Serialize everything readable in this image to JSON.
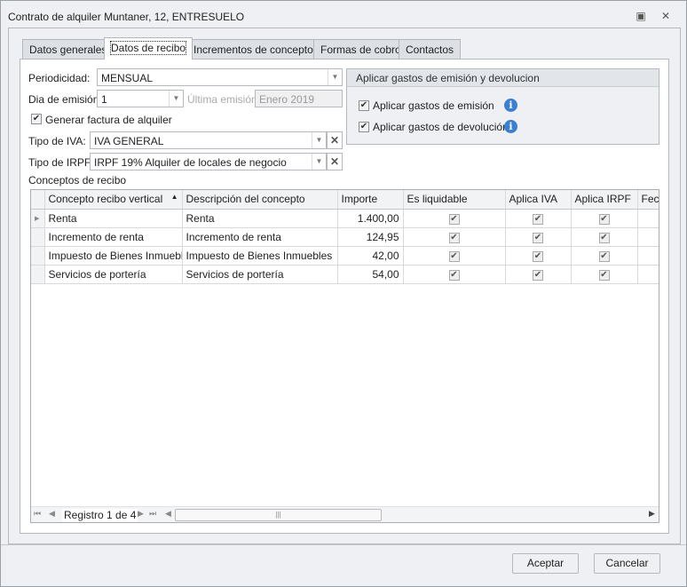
{
  "window": {
    "title": "Contrato de alquiler Muntaner, 12, ENTRESUELO"
  },
  "tabs": [
    "Datos generales",
    "Datos de recibo",
    "Incrementos de conceptos",
    "Formas de cobro",
    "Contactos"
  ],
  "form": {
    "periodicidad_label": "Periodicidad:",
    "periodicidad_value": "MENSUAL",
    "dia_label": "Dia de emisión:",
    "dia_value": "1",
    "ultima_label": "Última emisión:",
    "ultima_value": "Enero 2019",
    "generar_label": "Generar factura de alquiler",
    "generar_checked": true,
    "iva_label": "Tipo de IVA:",
    "iva_value": "IVA GENERAL",
    "irpf_label": "Tipo de IRPF:",
    "irpf_value": "IRPF 19% Alquiler de locales de negocio"
  },
  "gastos": {
    "title": "Aplicar gastos de emisión y devolucion",
    "emision_label": "Aplicar gastos de emisión",
    "devolucion_label": "Aplicar gastos de devolución"
  },
  "grid": {
    "title": "Conceptos de recibo",
    "columns": [
      "Concepto recibo vertical",
      "Descripción del concepto",
      "Importe",
      "Es liquidable",
      "Aplica IVA",
      "Aplica IRPF",
      "Fech"
    ],
    "rows": [
      {
        "concepto": "Renta",
        "descripcion": "Renta",
        "importe": "1.400,00"
      },
      {
        "concepto": "Incremento de renta",
        "descripcion": "Incremento de renta",
        "importe": "124,95"
      },
      {
        "concepto": "Impuesto de Bienes Inmuebles",
        "descripcion": "Impuesto de Bienes Inmuebles",
        "importe": "42,00"
      },
      {
        "concepto": "Servicios de portería",
        "descripcion": "Servicios de portería",
        "importe": "54,00"
      }
    ],
    "navigator": "Registro 1 de 4"
  },
  "buttons": {
    "accept": "Aceptar",
    "cancel": "Cancelar"
  }
}
